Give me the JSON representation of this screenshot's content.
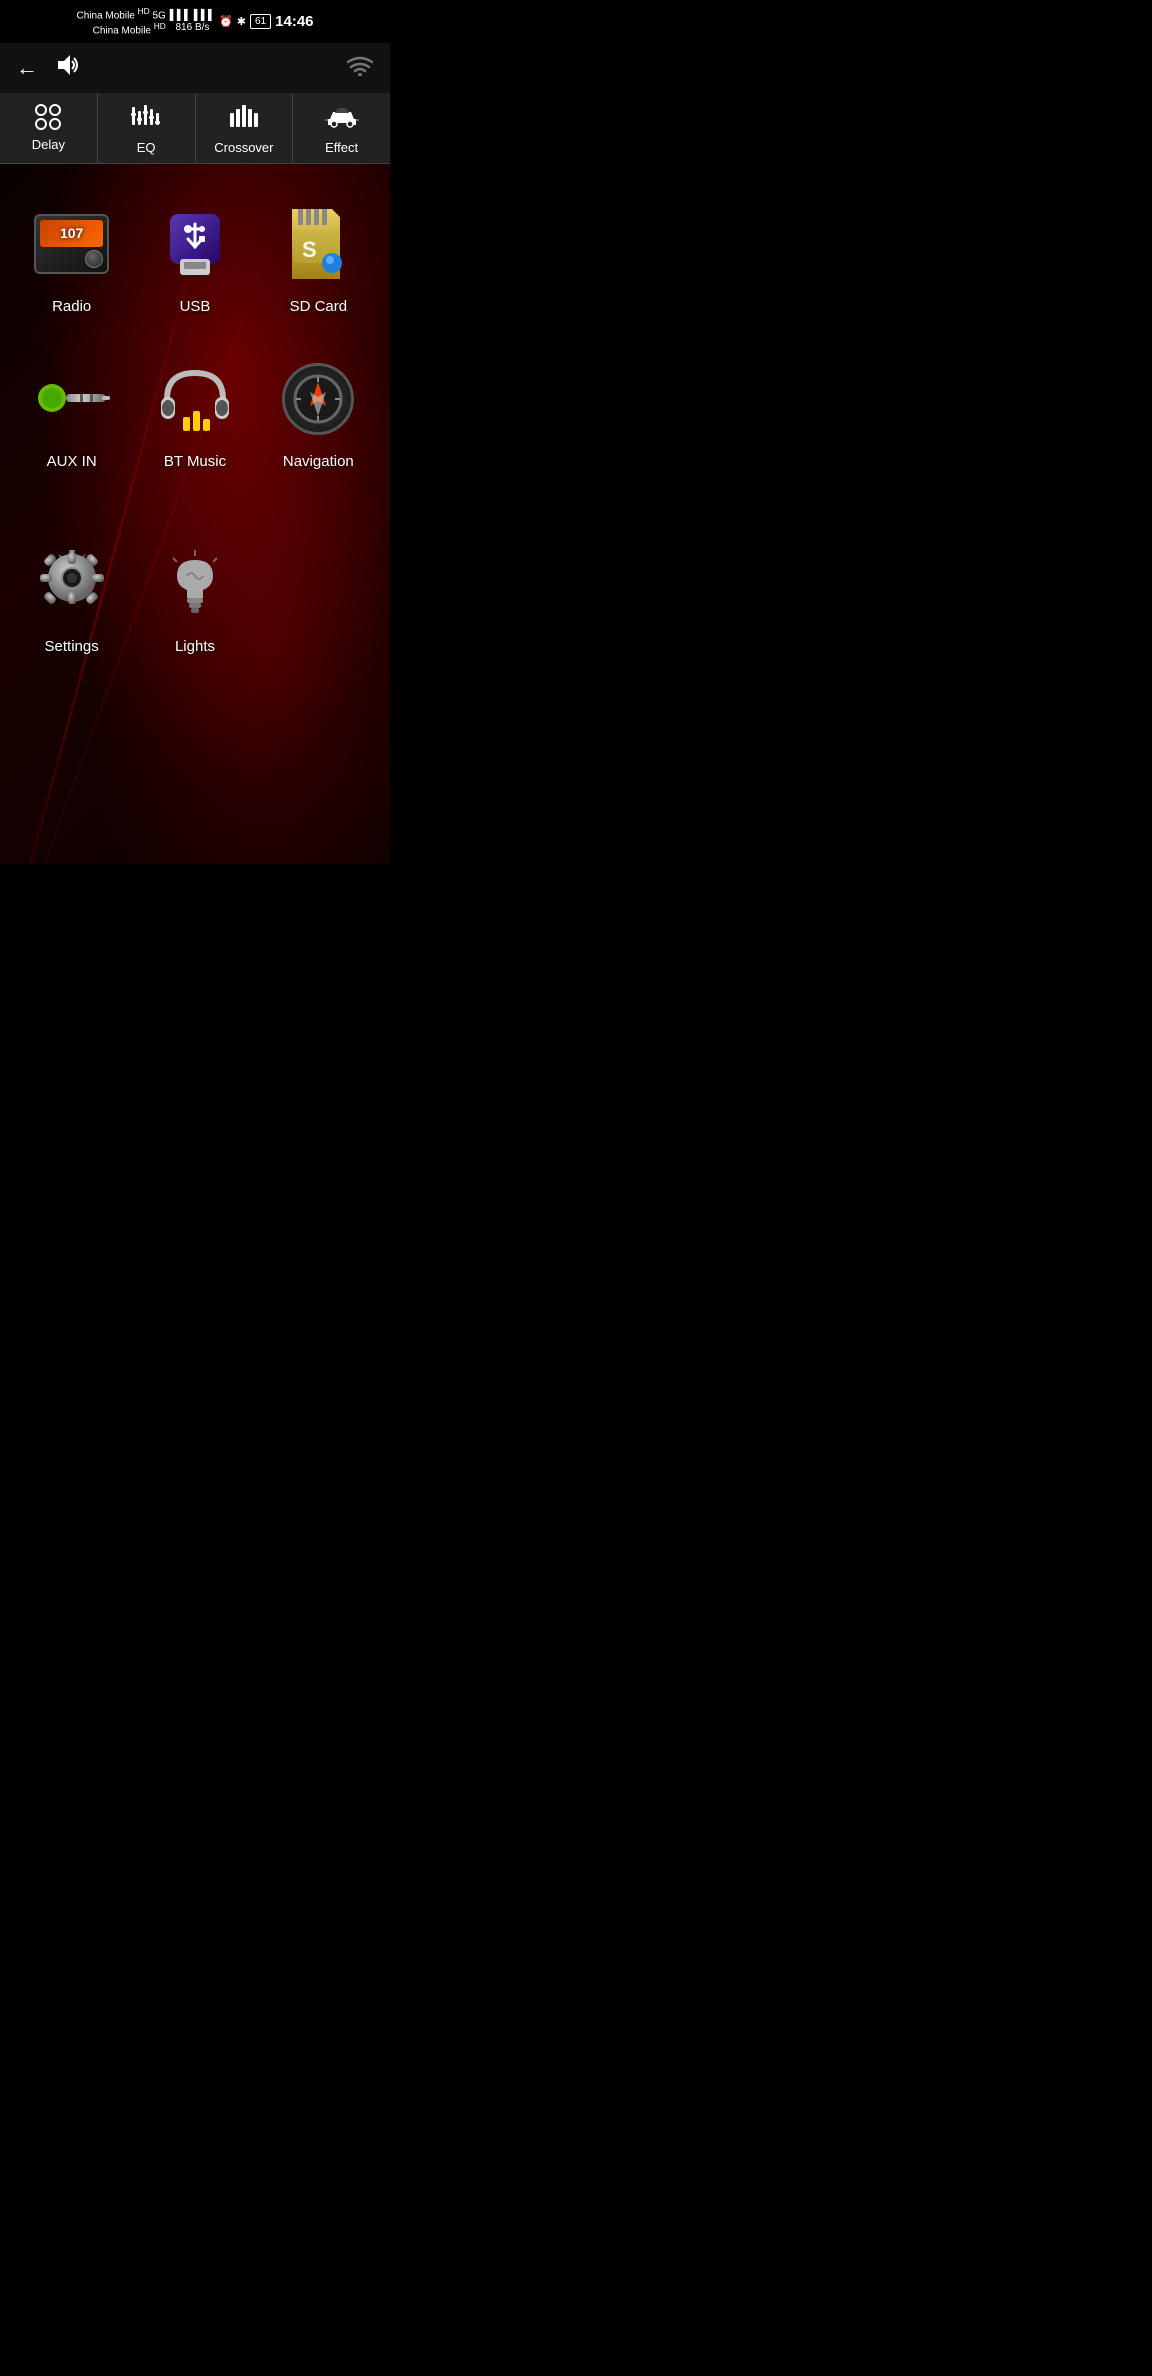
{
  "statusBar": {
    "carrier1": "China Mobile",
    "carrier1_badge": "HD",
    "carrier2": "China Mobile",
    "carrier2_badge": "HD",
    "network_speed": "816\nB/s",
    "time": "14:46",
    "battery": "61"
  },
  "tabs": [
    {
      "id": "delay",
      "label": "Delay"
    },
    {
      "id": "eq",
      "label": "EQ"
    },
    {
      "id": "crossover",
      "label": "Crossover"
    },
    {
      "id": "effect",
      "label": "Effect"
    }
  ],
  "apps": [
    {
      "id": "radio",
      "label": "Radio",
      "screen_text": "107"
    },
    {
      "id": "usb",
      "label": "USB"
    },
    {
      "id": "sdcard",
      "label": "SD Card"
    },
    {
      "id": "auxin",
      "label": "AUX IN"
    },
    {
      "id": "btmusic",
      "label": "BT Music"
    },
    {
      "id": "navigation",
      "label": "Navigation"
    },
    {
      "id": "settings",
      "label": "Settings"
    },
    {
      "id": "lights",
      "label": "Lights"
    }
  ]
}
